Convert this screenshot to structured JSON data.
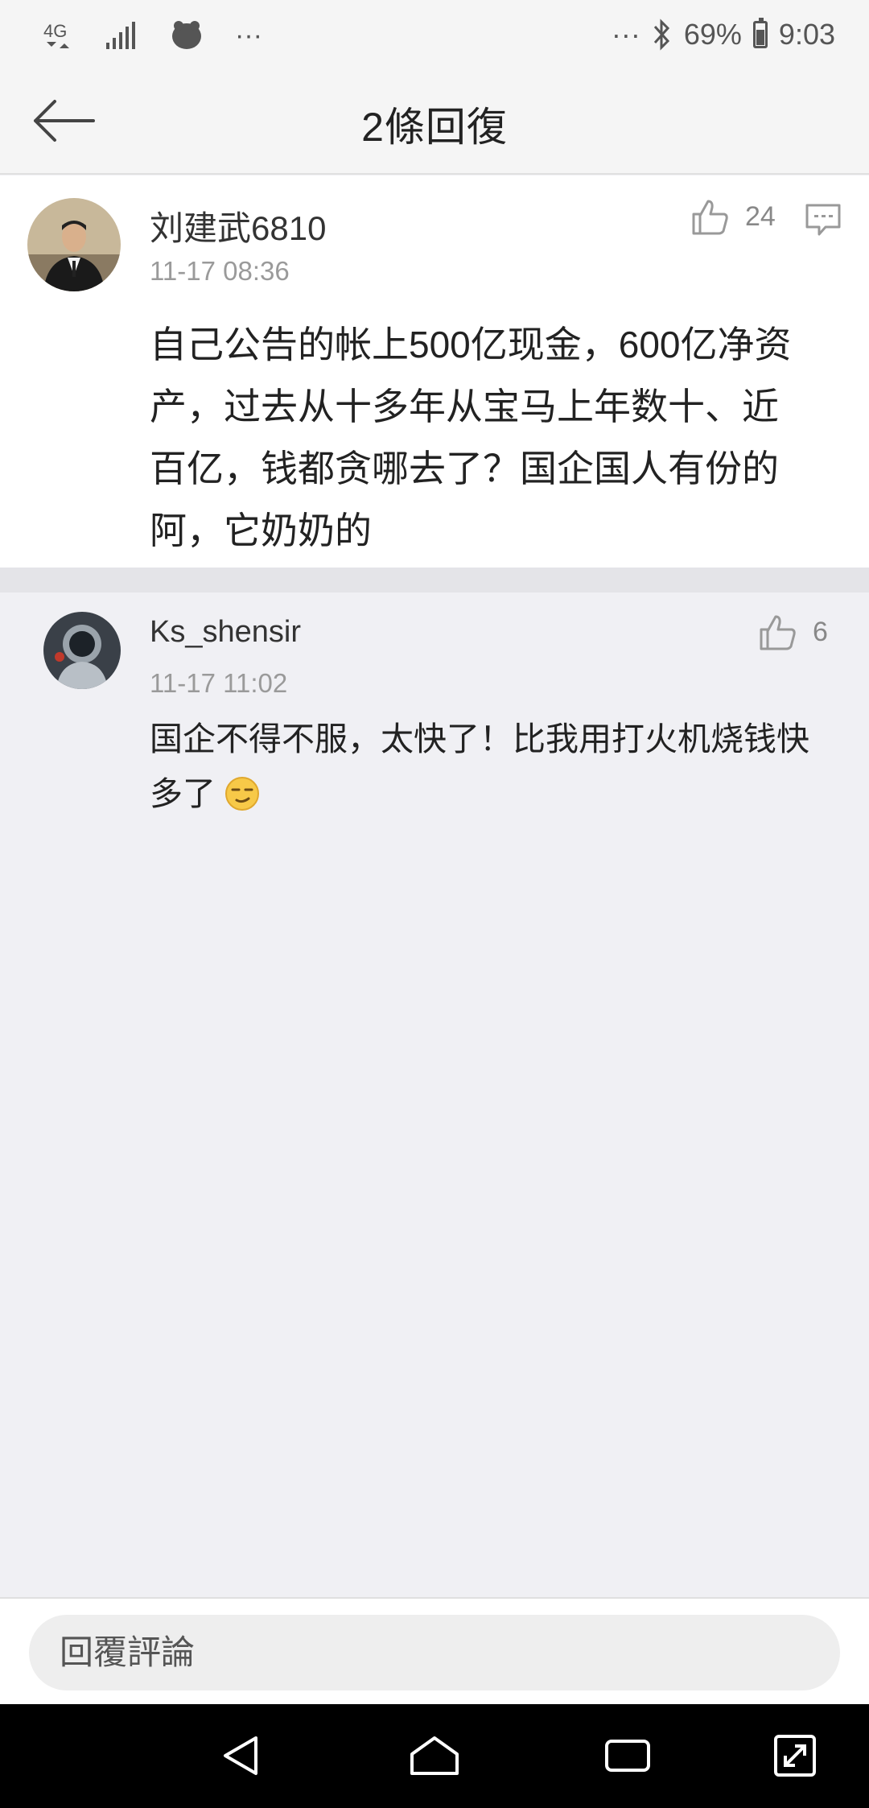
{
  "status_bar": {
    "network": "4G",
    "battery_percent": "69%",
    "time": "9:03",
    "left_more": "···",
    "right_more": "···"
  },
  "header": {
    "title": "2條回復",
    "back_icon": "back-arrow-icon"
  },
  "comments": [
    {
      "username": "刘建武6810",
      "timestamp": "11-17 08:36",
      "likes": "24",
      "text_lines": [
        "自己公告的帐上500亿现金，600亿净资",
        "产，过去从十多年从宝马上年数十、近",
        "百亿，钱都贪哪去了？国企国人有份的",
        "阿，它奶奶的"
      ]
    },
    {
      "username": "Ks_shensir",
      "timestamp": "11-17 11:02",
      "likes": "6",
      "text_lines": [
        "国企不得不服，太快了！比我用打火机烧钱快",
        "多了"
      ]
    }
  ],
  "bottom_bar": {
    "placeholder": "回覆評論"
  },
  "nav_bar": {
    "icons": [
      "back-triangle-icon",
      "home-icon",
      "recents-icon",
      "expand-icon"
    ]
  }
}
